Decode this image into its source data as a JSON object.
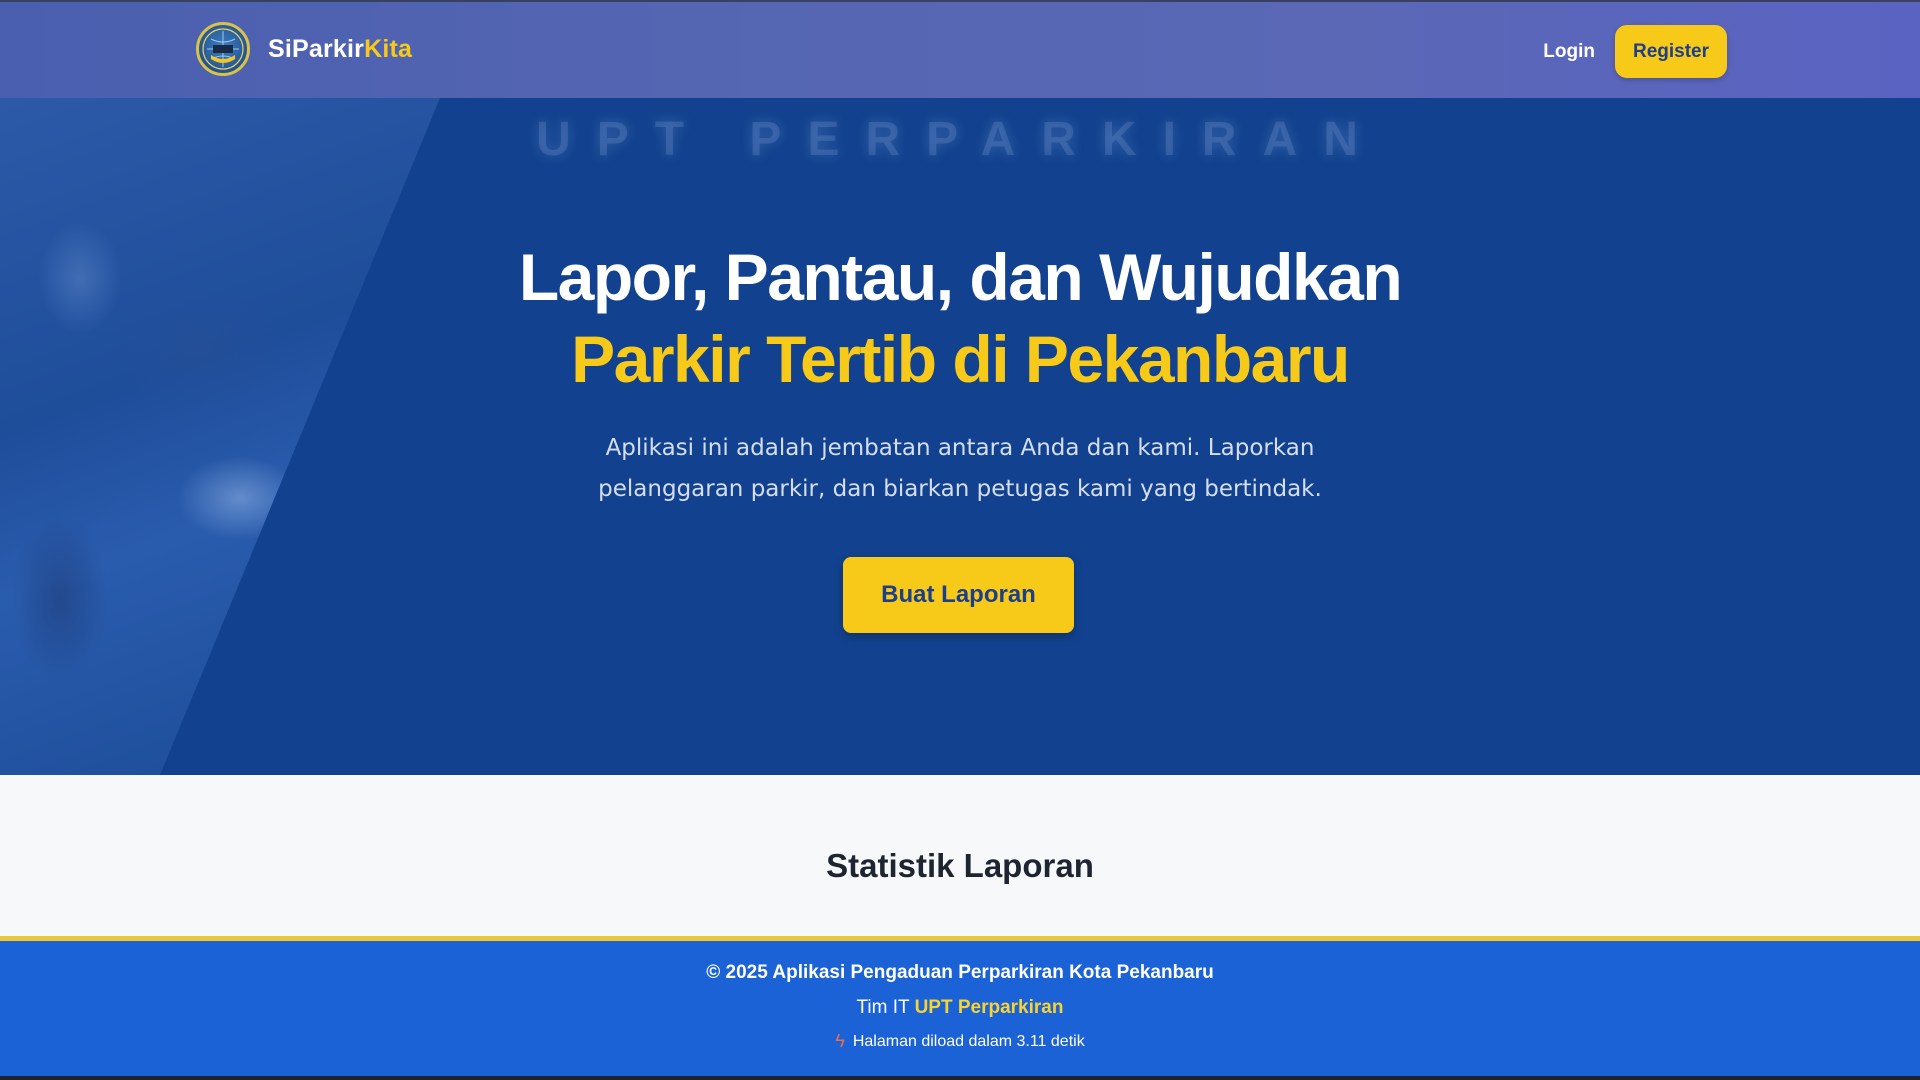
{
  "navbar": {
    "brand_main": "SiParkir",
    "brand_accent": "Kita",
    "logo_icon": "city-emblem-icon",
    "login_label": "Login",
    "register_label": "Register"
  },
  "hero": {
    "watermark": "UPT PERPARKIRAN",
    "title_line1": "Lapor, Pantau, dan Wujudkan",
    "title_line2": "Parkir Tertib di Pekanbaru",
    "description": "Aplikasi ini adalah jembatan antara Anda dan kami. Laporkan pelanggaran parkir, dan biarkan petugas kami yang bertindak.",
    "cta_label": "Buat Laporan"
  },
  "stats": {
    "title": "Statistik Laporan"
  },
  "footer": {
    "copyright": "© 2025 Aplikasi Pengaduan Perparkiran Kota Pekanbaru",
    "team_prefix": "Tim IT",
    "team_name": "UPT Perparkiran",
    "load_icon": "lightning-icon",
    "load_text": "Halaman diload dalam 3.11 detik"
  },
  "colors": {
    "primary_blue": "#12428f",
    "accent_yellow": "#f7c919",
    "footer_blue": "#1a62d6"
  }
}
